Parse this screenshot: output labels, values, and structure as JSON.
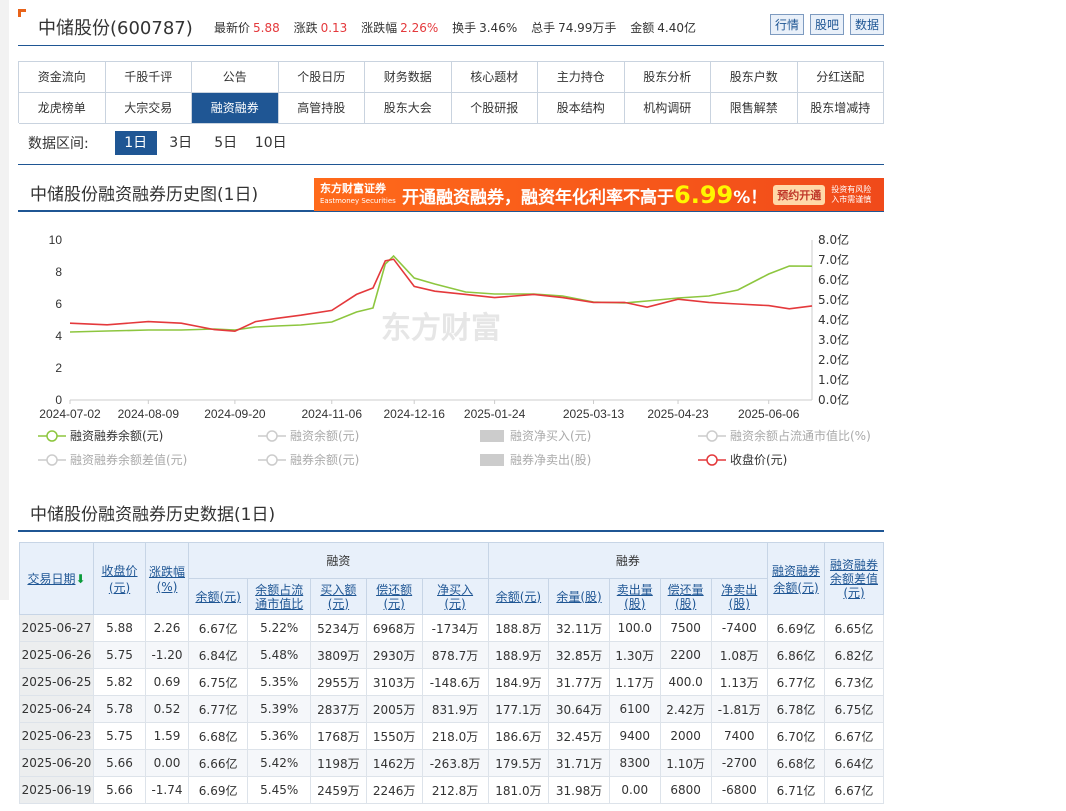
{
  "header": {
    "stock_name": "中储股份(600787)",
    "price_label": "最新价",
    "price": "5.88",
    "change_label": "涨跌",
    "change": "0.13",
    "pct_label": "涨跌幅",
    "pct": "2.26%",
    "turnover_label": "换手",
    "turnover": "3.46%",
    "volume_label": "总手",
    "volume": "74.99万手",
    "amount_label": "金额",
    "amount": "4.40亿",
    "buttons": [
      "行情",
      "股吧",
      "数据"
    ]
  },
  "tabs": [
    "资金流向",
    "千股千评",
    "公告",
    "个股日历",
    "财务数据",
    "核心题材",
    "主力持仓",
    "股东分析",
    "股东户数",
    "分红送配",
    "龙虎榜单",
    "大宗交易",
    "融资融券",
    "高管持股",
    "股东大会",
    "个股研报",
    "股本结构",
    "机构调研",
    "限售解禁",
    "股东增减持"
  ],
  "active_tab": "融资融券",
  "range": {
    "label": "数据区间:",
    "options": [
      "1日",
      "3日",
      "5日",
      "10日"
    ],
    "selected": "1日"
  },
  "chart_section": {
    "title": "中储股份融资融券历史图(1日)",
    "banner": {
      "logo": "东方财富证券",
      "logo_sub": "Eastmoney Securities",
      "text_a": "开通融资融券，融资年化利率不高于",
      "rate": "6.99",
      "text_b": "%！",
      "cta": "预约开通",
      "risk": "投资有风险\n入市需谨慎"
    },
    "watermark": "东方财富"
  },
  "chart_data": {
    "type": "line",
    "x_ticks": [
      "2024-07-02",
      "2024-08-09",
      "2024-09-20",
      "2024-11-06",
      "2024-12-16",
      "2025-01-24",
      "2025-03-13",
      "2025-04-23",
      "2025-06-06"
    ],
    "y_left": {
      "ticks": [
        "10",
        "8",
        "6",
        "4",
        "2",
        "0"
      ],
      "range": [
        0,
        10
      ]
    },
    "y_right": {
      "ticks": [
        "8.0亿",
        "7.0亿",
        "6.0亿",
        "5.0亿",
        "4.0亿",
        "3.0亿",
        "2.0亿",
        "1.0亿",
        "0.0亿"
      ],
      "range": [
        0,
        8
      ]
    },
    "series": [
      {
        "name": "融资融券余额(元)",
        "axis": "right",
        "color": "#8dc63f",
        "x": [
          "2024-07-02",
          "2024-07-20",
          "2024-08-09",
          "2024-08-25",
          "2024-09-10",
          "2024-09-20",
          "2024-09-30",
          "2024-10-10",
          "2024-10-22",
          "2024-11-06",
          "2024-11-18",
          "2024-11-26",
          "2024-12-02",
          "2024-12-06",
          "2024-12-16",
          "2024-12-26",
          "2025-01-10",
          "2025-01-24",
          "2025-02-12",
          "2025-02-26",
          "2025-03-13",
          "2025-03-28",
          "2025-04-08",
          "2025-04-23",
          "2025-05-08",
          "2025-05-22",
          "2025-06-06",
          "2025-06-16",
          "2025-06-27"
        ],
        "values": [
          3.4,
          3.45,
          3.5,
          3.5,
          3.55,
          3.5,
          3.65,
          3.7,
          3.75,
          3.9,
          4.4,
          4.6,
          6.8,
          7.2,
          6.1,
          5.8,
          5.4,
          5.3,
          5.3,
          5.2,
          4.9,
          4.85,
          4.95,
          5.1,
          5.2,
          5.5,
          6.3,
          6.7,
          6.69
        ]
      },
      {
        "name": "收盘价(元)",
        "axis": "left",
        "color": "#e4393c",
        "x": [
          "2024-07-02",
          "2024-07-20",
          "2024-08-09",
          "2024-08-25",
          "2024-09-10",
          "2024-09-20",
          "2024-09-30",
          "2024-10-10",
          "2024-10-22",
          "2024-11-06",
          "2024-11-18",
          "2024-11-26",
          "2024-12-02",
          "2024-12-06",
          "2024-12-16",
          "2024-12-26",
          "2025-01-10",
          "2025-01-24",
          "2025-02-12",
          "2025-02-26",
          "2025-03-13",
          "2025-03-28",
          "2025-04-08",
          "2025-04-23",
          "2025-05-08",
          "2025-05-22",
          "2025-06-06",
          "2025-06-16",
          "2025-06-27"
        ],
        "values": [
          4.8,
          4.7,
          4.9,
          4.8,
          4.4,
          4.3,
          4.9,
          5.1,
          5.3,
          5.6,
          6.6,
          7.0,
          8.7,
          8.8,
          7.1,
          6.8,
          6.6,
          6.4,
          6.6,
          6.4,
          6.1,
          6.1,
          5.8,
          6.3,
          6.1,
          6.0,
          5.9,
          5.7,
          5.88
        ]
      }
    ],
    "legend": [
      {
        "label": "融资融券余额(元)",
        "active": true,
        "color": "#8dc63f",
        "kind": "line"
      },
      {
        "label": "融资余额(元)",
        "active": false,
        "kind": "line"
      },
      {
        "label": "融资净买入(元)",
        "active": false,
        "kind": "bar"
      },
      {
        "label": "融资余额占流通市值比(%)",
        "active": false,
        "kind": "line"
      },
      {
        "label": "融资融券余额差值(元)",
        "active": false,
        "kind": "line"
      },
      {
        "label": "融券余额(元)",
        "active": false,
        "kind": "line"
      },
      {
        "label": "融券净卖出(股)",
        "active": false,
        "kind": "bar"
      },
      {
        "label": "收盘价(元)",
        "active": true,
        "color": "#e4393c",
        "kind": "line"
      }
    ],
    "grid": false,
    "legend_placement": "bottom"
  },
  "table_section": {
    "title": "中储股份融资融券历史数据(1日)",
    "headers": {
      "date": "交易日期",
      "close": "收盘价\n(元)",
      "chg": "涨跌幅\n(%)",
      "rz_group": "融资",
      "rq_group": "融券",
      "rz": [
        "余额(元)",
        "余额占流\n通市值比",
        "买入额\n(元)",
        "偿还额\n(元)",
        "净买入\n(元)"
      ],
      "rq": [
        "余额(元)",
        "余量(股)",
        "卖出量\n(股)",
        "偿还量\n(股)",
        "净卖出\n(股)"
      ],
      "total": "融资融券\n余额(元)",
      "diff": "融资融券\n余额差值\n(元)"
    },
    "rows": [
      [
        "2025-06-27",
        "5.88",
        "2.26",
        "6.67亿",
        "5.22%",
        "5234万",
        "6968万",
        "-1734万",
        "188.8万",
        "32.11万",
        "100.0",
        "7500",
        "-7400",
        "6.69亿",
        "6.65亿"
      ],
      [
        "2025-06-26",
        "5.75",
        "-1.20",
        "6.84亿",
        "5.48%",
        "3809万",
        "2930万",
        "878.7万",
        "188.9万",
        "32.85万",
        "1.30万",
        "2200",
        "1.08万",
        "6.86亿",
        "6.82亿"
      ],
      [
        "2025-06-25",
        "5.82",
        "0.69",
        "6.75亿",
        "5.35%",
        "2955万",
        "3103万",
        "-148.6万",
        "184.9万",
        "31.77万",
        "1.17万",
        "400.0",
        "1.13万",
        "6.77亿",
        "6.73亿"
      ],
      [
        "2025-06-24",
        "5.78",
        "0.52",
        "6.77亿",
        "5.39%",
        "2837万",
        "2005万",
        "831.9万",
        "177.1万",
        "30.64万",
        "6100",
        "2.42万",
        "-1.81万",
        "6.78亿",
        "6.75亿"
      ],
      [
        "2025-06-23",
        "5.75",
        "1.59",
        "6.68亿",
        "5.36%",
        "1768万",
        "1550万",
        "218.0万",
        "186.6万",
        "32.45万",
        "9400",
        "2000",
        "7400",
        "6.70亿",
        "6.67亿"
      ],
      [
        "2025-06-20",
        "5.66",
        "0.00",
        "6.66亿",
        "5.42%",
        "1198万",
        "1462万",
        "-263.8万",
        "179.5万",
        "31.71万",
        "8300",
        "1.10万",
        "-2700",
        "6.68亿",
        "6.64亿"
      ],
      [
        "2025-06-19",
        "5.66",
        "-1.74",
        "6.69亿",
        "5.45%",
        "2459万",
        "2246万",
        "212.8万",
        "181.0万",
        "31.98万",
        "0.00",
        "6800",
        "-6800",
        "6.71亿",
        "6.67亿"
      ]
    ]
  }
}
